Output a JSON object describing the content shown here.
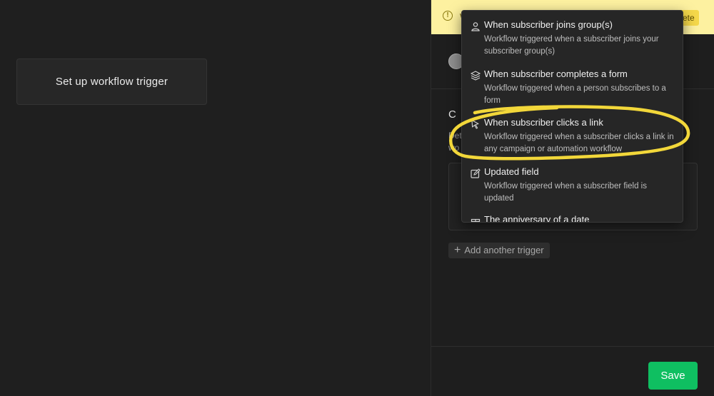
{
  "canvas": {
    "trigger_card_label": "Set up workflow trigger"
  },
  "panel": {
    "warning_letter": "W",
    "warning_button_label": "ete",
    "section_title_letter": "C",
    "description_lines": [
      "Det",
      "wo"
    ],
    "add_trigger_label": "Add another trigger",
    "save_label": "Save"
  },
  "dropdown": {
    "items": [
      {
        "icon": "person-icon",
        "title": "When subscriber joins group(s)",
        "description": "Workflow triggered when a subscriber joins your subscriber group(s)"
      },
      {
        "icon": "layers-icon",
        "title": "When subscriber completes a form",
        "description": "Workflow triggered when a person subscribes to a form"
      },
      {
        "icon": "cursor-arrow-icon",
        "title": "When subscriber clicks a link",
        "description": "Workflow triggered when a subscriber clicks a link in any campaign or automation workflow"
      },
      {
        "icon": "edit-icon",
        "title": "Updated field",
        "description": "Workflow triggered when a subscriber field is updated"
      },
      {
        "icon": "gift-icon",
        "title": "The anniversary of a date",
        "description": ""
      }
    ]
  },
  "colors": {
    "background": "#1f1f1f",
    "warning_banner": "#fdf1a0",
    "save_button": "#0fbf61",
    "highlight_annotation": "#f2d73a"
  }
}
